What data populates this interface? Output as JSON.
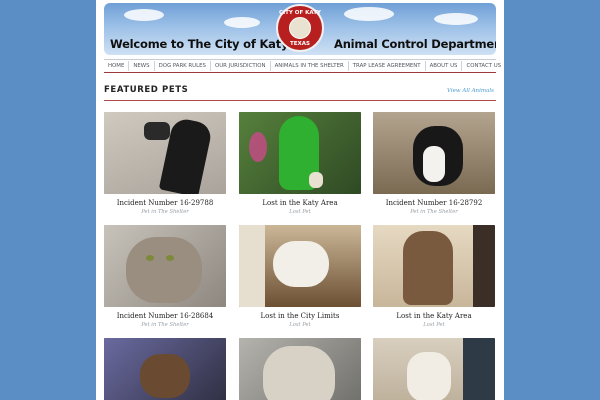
{
  "banner": {
    "left_text": "Welcome to The City of Katy",
    "right_text": "Animal Control Department",
    "seal_top": "CITY OF KATY",
    "seal_bottom": "TEXAS"
  },
  "nav": {
    "items": [
      "HOME",
      "NEWS",
      "DOG PARK RULES",
      "OUR JURISDICTION",
      "ANIMALS IN THE SHELTER",
      "TRAP LEASE AGREEMENT",
      "ABOUT US",
      "CONTACT US"
    ]
  },
  "featured": {
    "title": "FEATURED PETS",
    "view_all": "View All Animals"
  },
  "pets": [
    {
      "title": "Incident Number 16-29788",
      "category": "Pet in The Shelter"
    },
    {
      "title": "Lost in the Katy Area",
      "category": "Lost Pet"
    },
    {
      "title": "Incident Number 16-28792",
      "category": "Pet in The Shelter"
    },
    {
      "title": "Incident Number 16-28684",
      "category": "Pet in The Shelter"
    },
    {
      "title": "Lost in the City Limits",
      "category": "Lost Pet"
    },
    {
      "title": "Lost in the Katy Area",
      "category": "Lost Pet"
    }
  ]
}
